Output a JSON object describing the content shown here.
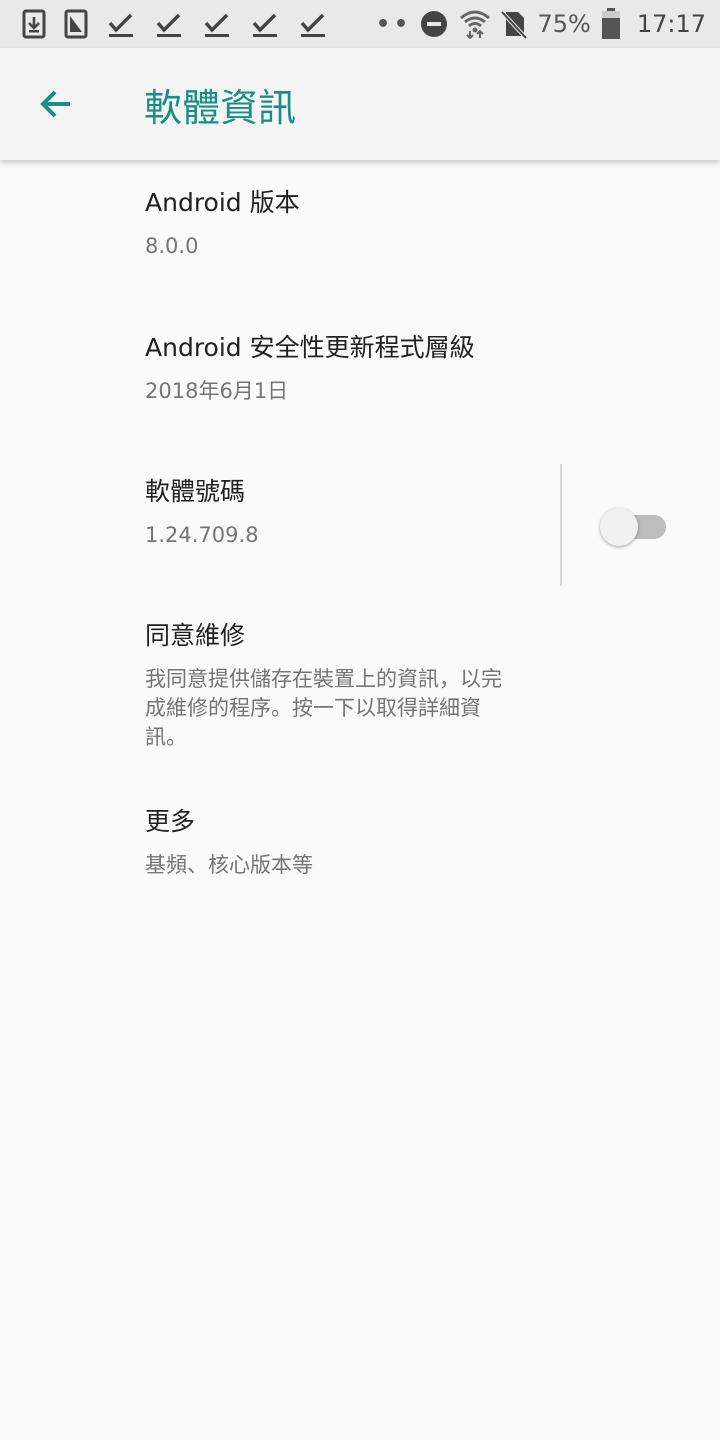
{
  "status_bar": {
    "left_icons": [
      "download-icon",
      "screenshot-icon",
      "check-icon",
      "check-icon",
      "check-icon",
      "check-icon",
      "check-icon"
    ],
    "more_indicator": "••",
    "battery_percent": "75%",
    "time": "17:17"
  },
  "app_bar": {
    "title": "軟體資訊"
  },
  "items": [
    {
      "title": "Android 版本",
      "summary": "8.0.0"
    },
    {
      "title": "Android 安全性更新程式層級",
      "summary": "2018年6月1日"
    },
    {
      "title": "軟體號碼",
      "summary": "1.24.709.8"
    },
    {
      "title": "同意維修",
      "summary": "我同意提供儲存在裝置上的資訊，以完成維修的程序。按一下以取得詳細資訊。",
      "switch_on": false
    },
    {
      "title": "更多",
      "summary": "基頻、核心版本等"
    }
  ],
  "colors": {
    "accent": "#188f85",
    "title_text": "#212121",
    "summary_text": "#757575",
    "switch_off_track": "#bdbdbd"
  }
}
